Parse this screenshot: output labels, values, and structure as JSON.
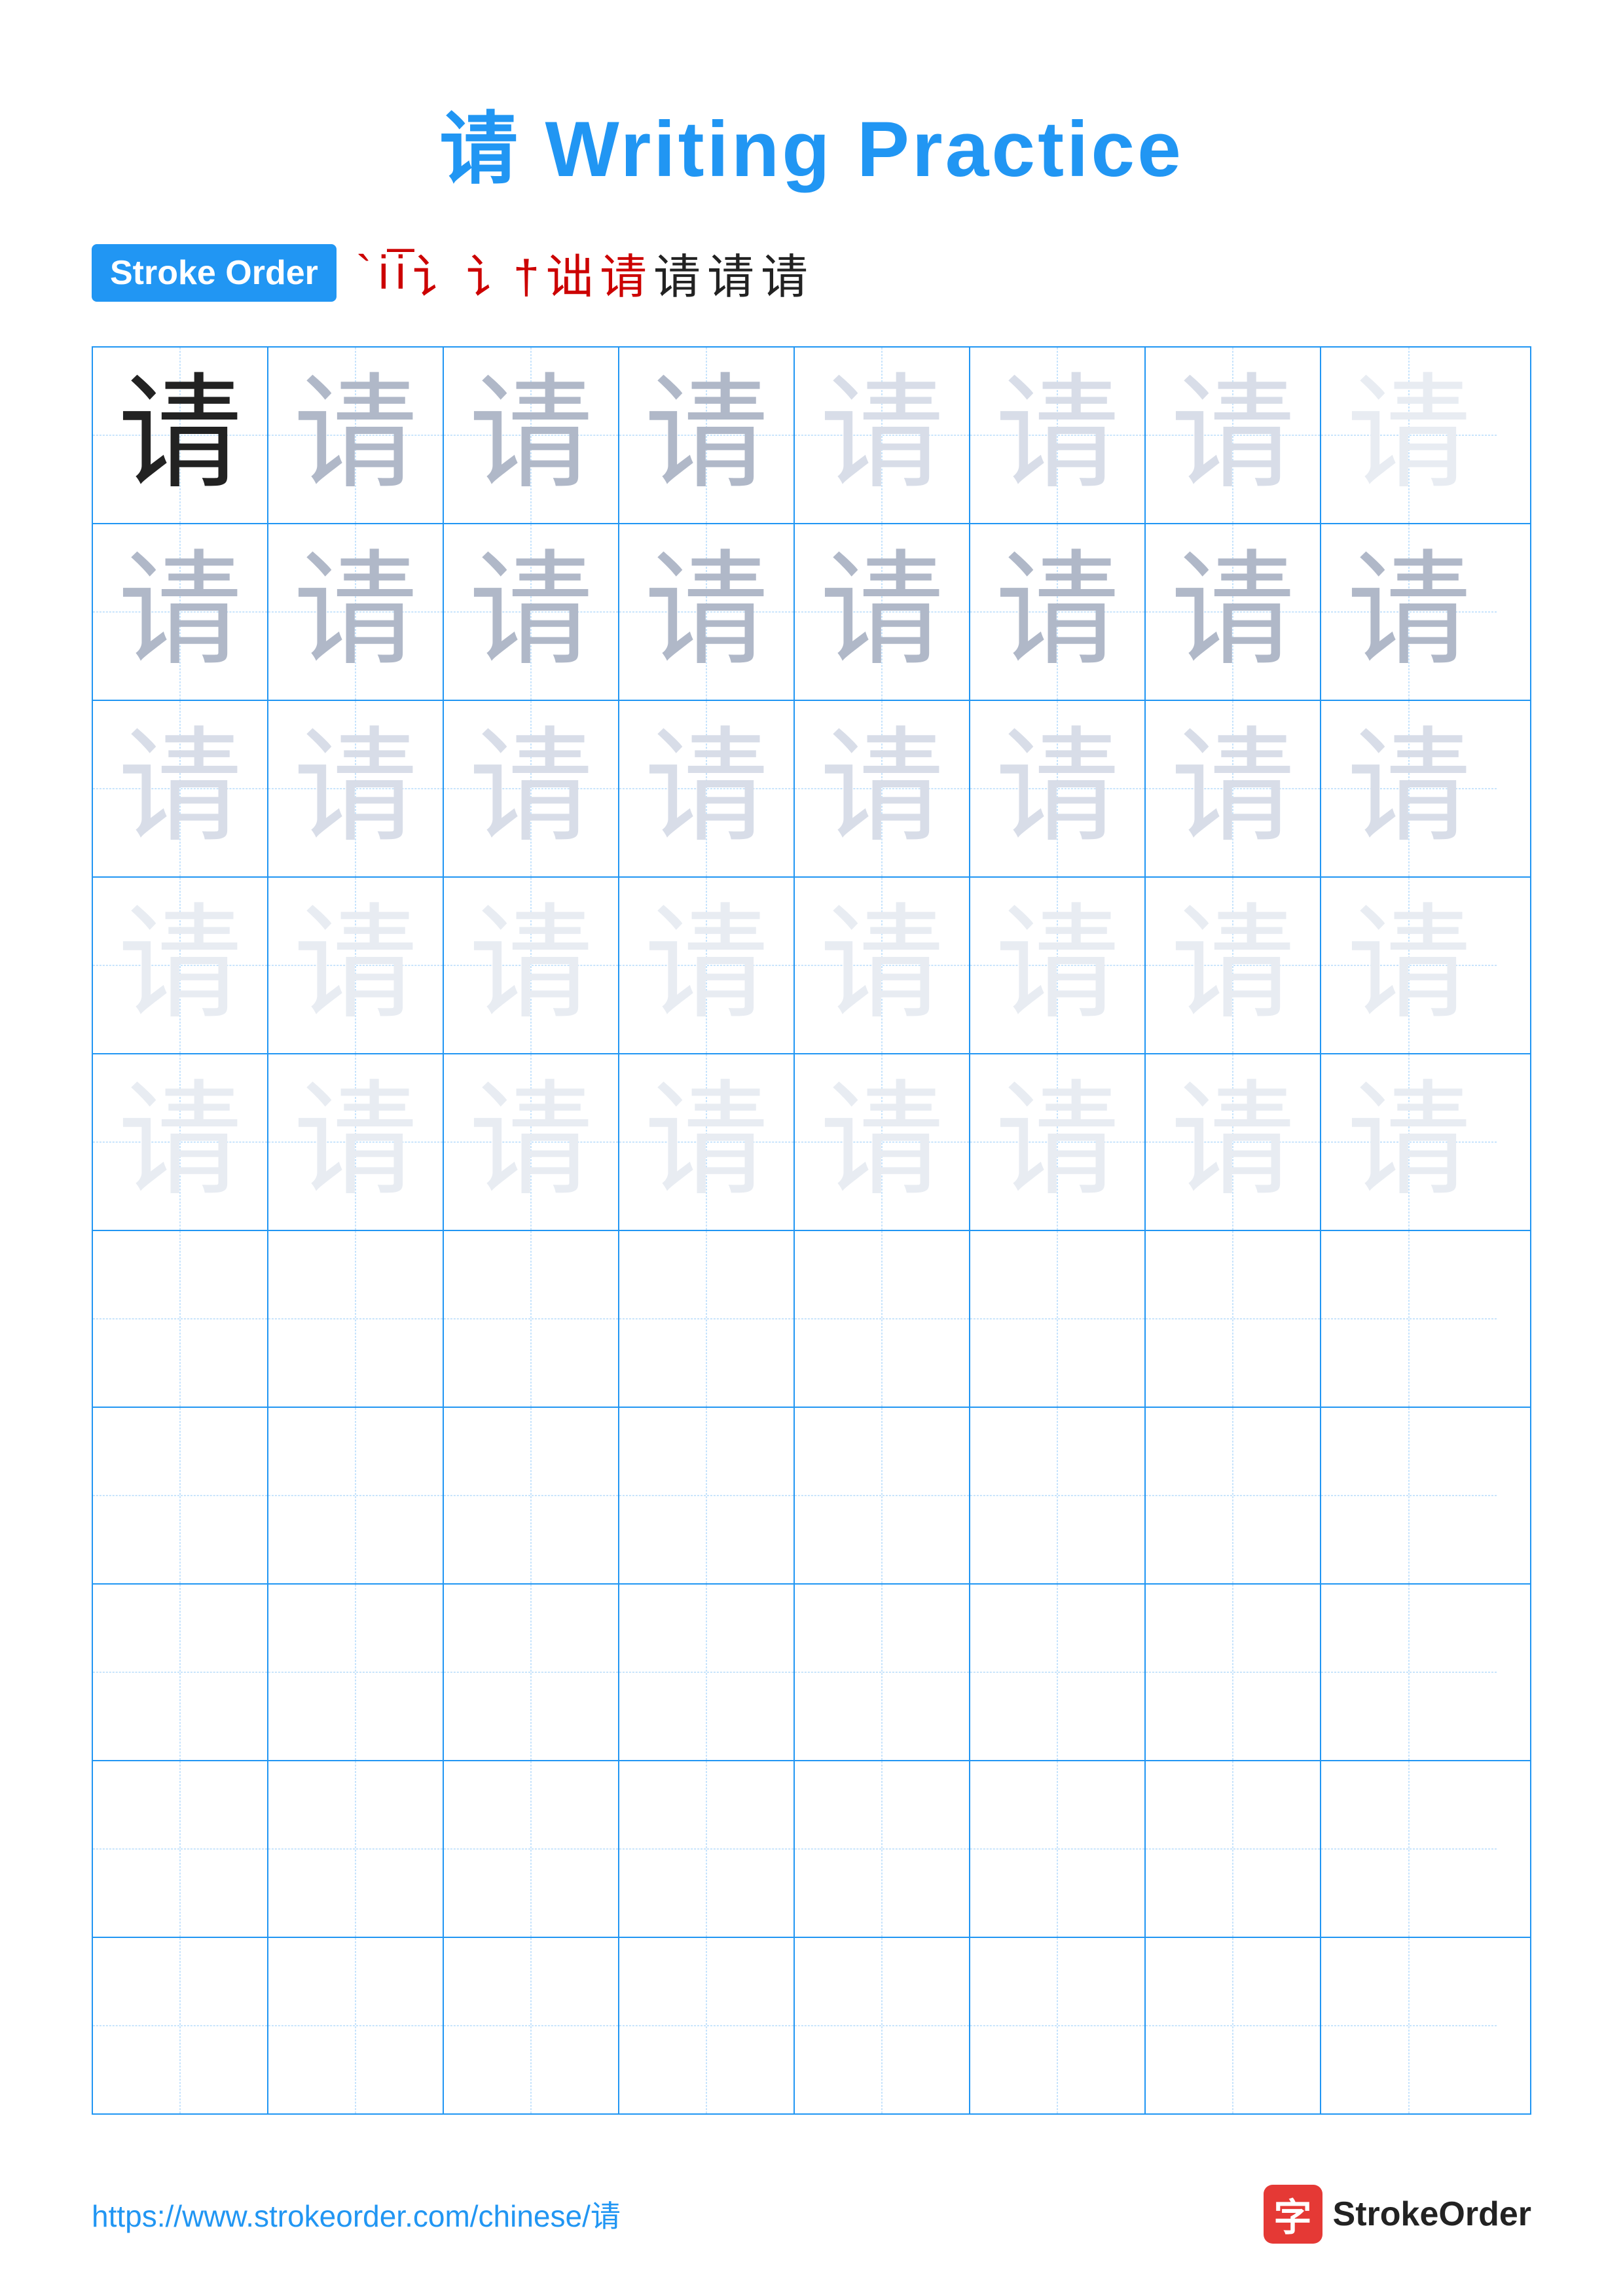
{
  "page": {
    "title": "请 Writing Practice",
    "title_color": "#2196F3"
  },
  "stroke_order": {
    "badge_label": "Stroke Order",
    "steps": [
      "`",
      "i",
      "i¯",
      "i¬",
      "i✦",
      "讠",
      "讠+",
      "请",
      "请",
      "请"
    ]
  },
  "grid": {
    "rows": 10,
    "cols": 8,
    "character": "请"
  },
  "footer": {
    "url": "https://www.strokeorder.com/chinese/请",
    "brand": "StrokeOrder",
    "brand_char": "字"
  }
}
